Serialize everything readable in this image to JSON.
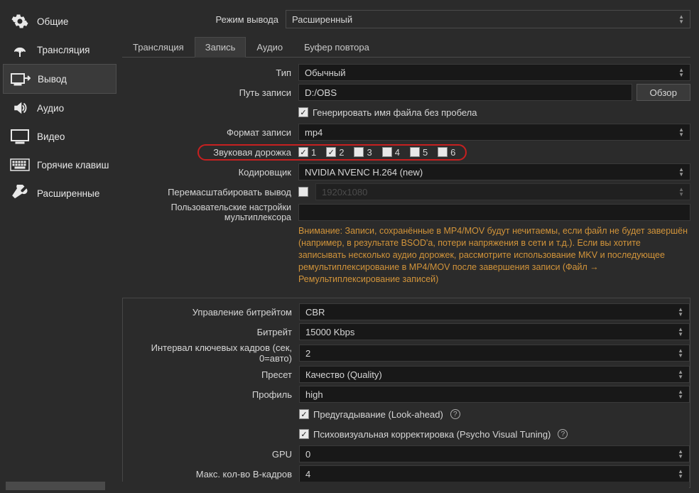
{
  "sidebar": {
    "items": [
      {
        "label": "Общие"
      },
      {
        "label": "Трансляция"
      },
      {
        "label": "Вывод"
      },
      {
        "label": "Аудио"
      },
      {
        "label": "Видео"
      },
      {
        "label": "Горячие клавиш"
      },
      {
        "label": "Расширенные"
      }
    ]
  },
  "header": {
    "output_mode_label": "Режим вывода",
    "output_mode_value": "Расширенный"
  },
  "tabs": {
    "stream": "Трансляция",
    "record": "Запись",
    "audio": "Аудио",
    "replay": "Буфер повтора"
  },
  "record": {
    "type_label": "Тип",
    "type_value": "Обычный",
    "path_label": "Путь записи",
    "path_value": "D:/OBS",
    "browse": "Обзор",
    "gen_filename": "Генерировать имя файла без пробела",
    "format_label": "Формат записи",
    "format_value": "mp4",
    "tracks_label": "Звуковая дорожка",
    "tracks": [
      "1",
      "2",
      "3",
      "4",
      "5",
      "6"
    ],
    "encoder_label": "Кодировщик",
    "encoder_value": "NVIDIA NVENC H.264 (new)",
    "rescale_label": "Перемасштабировать вывод",
    "rescale_value": "1920x1080",
    "mux_label": "Пользовательские настройки мультиплексора",
    "warning": "Внимание: Записи, сохранённые в MP4/MOV будут нечитаемы, если файл не будет завершён (например, в результате BSOD'а, потери напряжения в сети и т.д.). Если вы хотите записывать несколько аудио дорожек, рассмотрите использование MKV и последующее ремультиплексирование в MP4/MOV после завершения записи (Файл → Ремультиплексирование записей)"
  },
  "enc": {
    "rc_label": "Управление битрейтом",
    "rc_value": "CBR",
    "bitrate_label": "Битрейт",
    "bitrate_value": "15000 Kbps",
    "keyint_label": "Интервал ключевых кадров (сек, 0=авто)",
    "keyint_value": "2",
    "preset_label": "Пресет",
    "preset_value": "Качество (Quality)",
    "profile_label": "Профиль",
    "profile_value": "high",
    "lookahead": "Предугадывание (Look-ahead)",
    "psycho": "Психовизуальная корректировка (Psycho Visual Tuning)",
    "gpu_label": "GPU",
    "gpu_value": "0",
    "bframes_label": "Макс. кол-во B-кадров",
    "bframes_value": "4"
  }
}
